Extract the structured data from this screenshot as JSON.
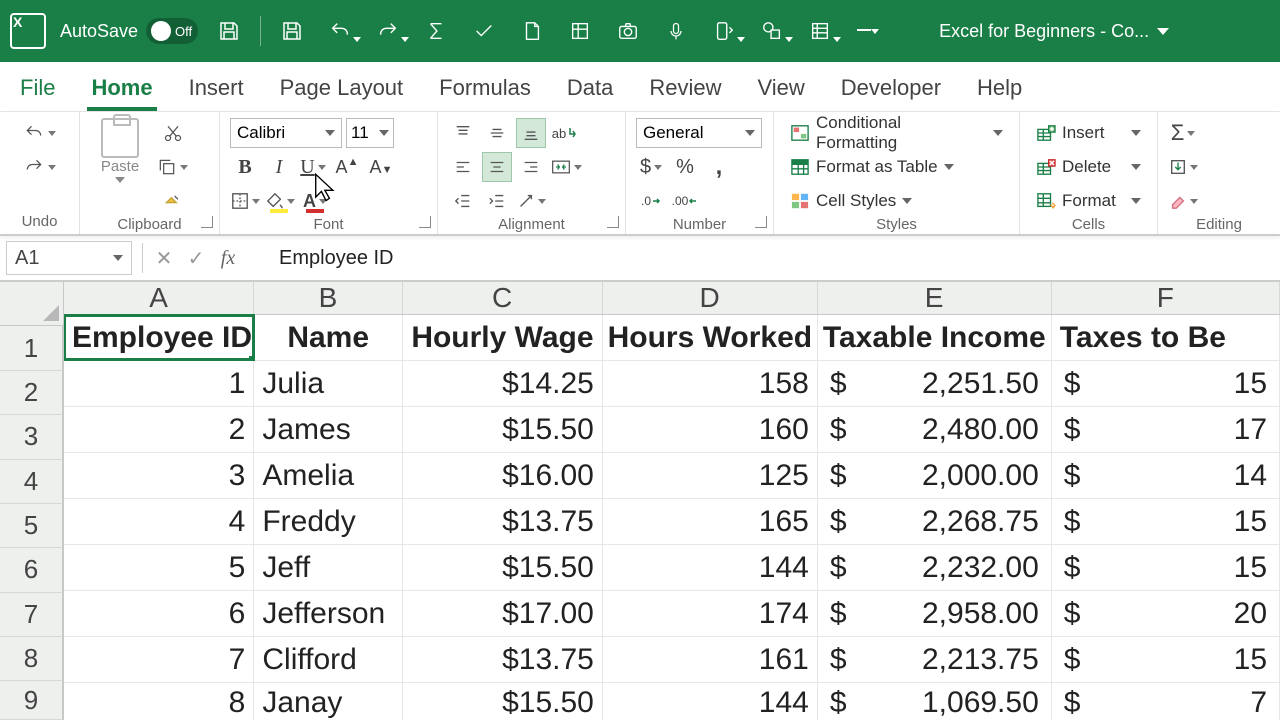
{
  "title_bar": {
    "autosave_label": "AutoSave",
    "autosave_state": "Off",
    "doc_title": "Excel for Beginners - Co..."
  },
  "tabs": {
    "file": "File",
    "items": [
      "Home",
      "Insert",
      "Page Layout",
      "Formulas",
      "Data",
      "Review",
      "View",
      "Developer",
      "Help"
    ],
    "active": "Home"
  },
  "ribbon": {
    "undo_label": "Undo",
    "clipboard_label": "Clipboard",
    "paste_label": "Paste",
    "font_label": "Font",
    "font_name": "Calibri",
    "font_size": "11",
    "alignment_label": "Alignment",
    "number_label": "Number",
    "number_format": "General",
    "styles_label": "Styles",
    "style_cond": "Conditional Formatting",
    "style_table": "Format as Table",
    "style_cell": "Cell Styles",
    "cells_label": "Cells",
    "cells_insert": "Insert",
    "cells_delete": "Delete",
    "cells_format": "Format",
    "editing_label": "Editing"
  },
  "formula_bar": {
    "cell_ref": "A1",
    "value": "Employee ID"
  },
  "grid": {
    "columns": [
      "A",
      "B",
      "C",
      "D",
      "E",
      "F"
    ],
    "headers": [
      "Employee ID",
      "Name",
      "Hourly Wage",
      "Hours Worked",
      "Taxable Income",
      "Taxes to Be"
    ],
    "rows": [
      {
        "id": "1",
        "name": "Julia",
        "wage": "$14.25",
        "hours": "158",
        "income": "2,251.50",
        "tax": "15"
      },
      {
        "id": "2",
        "name": "James",
        "wage": "$15.50",
        "hours": "160",
        "income": "2,480.00",
        "tax": "17"
      },
      {
        "id": "3",
        "name": "Amelia",
        "wage": "$16.00",
        "hours": "125",
        "income": "2,000.00",
        "tax": "14"
      },
      {
        "id": "4",
        "name": "Freddy",
        "wage": "$13.75",
        "hours": "165",
        "income": "2,268.75",
        "tax": "15"
      },
      {
        "id": "5",
        "name": "Jeff",
        "wage": "$15.50",
        "hours": "144",
        "income": "2,232.00",
        "tax": "15"
      },
      {
        "id": "6",
        "name": "Jefferson",
        "wage": "$17.00",
        "hours": "174",
        "income": "2,958.00",
        "tax": "20"
      },
      {
        "id": "7",
        "name": "Clifford",
        "wage": "$13.75",
        "hours": "161",
        "income": "2,213.75",
        "tax": "15"
      },
      {
        "id": "8",
        "name": "Janay",
        "wage": "$15.50",
        "hours": "144",
        "income": "1,069.50",
        "tax": "7"
      }
    ],
    "currency": "$",
    "row_numbers": [
      "1",
      "2",
      "3",
      "4",
      "5",
      "6",
      "7",
      "8",
      "9"
    ]
  }
}
